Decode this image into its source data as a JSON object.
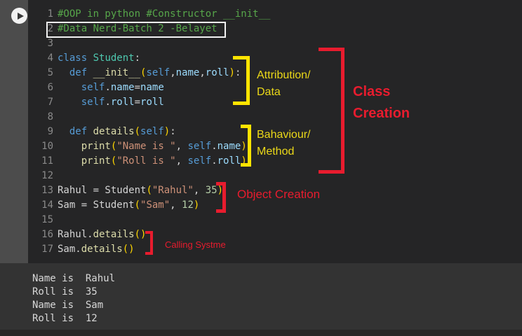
{
  "colors": {
    "editor_bg": "#252526",
    "sidebar_bg": "#4c4c4c",
    "console_bg": "#333333",
    "annotation_yellow": "#ffe400",
    "annotation_red": "#e81c2e",
    "comment_green": "#57a64a",
    "keyword_blue": "#569cd6",
    "function_yellow": "#dcdcaa",
    "string_orange": "#ce9178",
    "number_green": "#b5cea8",
    "param_blue": "#9cdcfe"
  },
  "run_button": {
    "icon": "play-icon"
  },
  "editor": {
    "lines": [
      {
        "num": "1",
        "segments": [
          [
            "com",
            "#OOP in python #Constructor __init__"
          ]
        ]
      },
      {
        "num": "2",
        "segments": [
          [
            "com",
            "#Data Nerd-Batch 2 -Belayet"
          ]
        ]
      },
      {
        "num": "3",
        "segments": []
      },
      {
        "num": "4",
        "segments": [
          [
            "kw",
            "class"
          ],
          [
            "pl",
            " "
          ],
          [
            "cls",
            "Student"
          ],
          [
            "pl",
            ":"
          ]
        ]
      },
      {
        "num": "5",
        "segments": [
          [
            "pl",
            "  "
          ],
          [
            "kw",
            "def"
          ],
          [
            "pl",
            " "
          ],
          [
            "fn",
            "__init__"
          ],
          [
            "gold",
            "("
          ],
          [
            "kw",
            "self"
          ],
          [
            "pl",
            ","
          ],
          [
            "prm",
            "name"
          ],
          [
            "pl",
            ","
          ],
          [
            "prm",
            "roll"
          ],
          [
            "gold",
            ")"
          ],
          [
            "pl",
            ":"
          ]
        ]
      },
      {
        "num": "6",
        "segments": [
          [
            "pl",
            "    "
          ],
          [
            "kw",
            "self"
          ],
          [
            "pl",
            "."
          ],
          [
            "prm",
            "name"
          ],
          [
            "pl",
            "="
          ],
          [
            "prm",
            "name"
          ]
        ]
      },
      {
        "num": "7",
        "segments": [
          [
            "pl",
            "    "
          ],
          [
            "kw",
            "self"
          ],
          [
            "pl",
            "."
          ],
          [
            "prm",
            "roll"
          ],
          [
            "pl",
            "="
          ],
          [
            "prm",
            "roll"
          ]
        ]
      },
      {
        "num": "8",
        "segments": []
      },
      {
        "num": "9",
        "segments": [
          [
            "pl",
            "  "
          ],
          [
            "kw",
            "def"
          ],
          [
            "pl",
            " "
          ],
          [
            "fn",
            "details"
          ],
          [
            "gold",
            "("
          ],
          [
            "kw",
            "self"
          ],
          [
            "gold",
            ")"
          ],
          [
            "pl",
            ":"
          ]
        ]
      },
      {
        "num": "10",
        "segments": [
          [
            "pl",
            "    "
          ],
          [
            "fn",
            "print"
          ],
          [
            "gold",
            "("
          ],
          [
            "str",
            "\"Name is \""
          ],
          [
            "pl",
            ", "
          ],
          [
            "kw",
            "self"
          ],
          [
            "pl",
            "."
          ],
          [
            "prm",
            "name"
          ],
          [
            "gold",
            ")"
          ]
        ]
      },
      {
        "num": "11",
        "segments": [
          [
            "pl",
            "    "
          ],
          [
            "fn",
            "print"
          ],
          [
            "gold",
            "("
          ],
          [
            "str",
            "\"Roll is \""
          ],
          [
            "pl",
            ", "
          ],
          [
            "kw",
            "self"
          ],
          [
            "pl",
            "."
          ],
          [
            "prm",
            "roll"
          ],
          [
            "gold",
            ")"
          ]
        ]
      },
      {
        "num": "12",
        "segments": []
      },
      {
        "num": "13",
        "segments": [
          [
            "pl",
            "Rahul = Student"
          ],
          [
            "gold",
            "("
          ],
          [
            "str",
            "\"Rahul\""
          ],
          [
            "pl",
            ", "
          ],
          [
            "num",
            "35"
          ],
          [
            "gold",
            ")"
          ]
        ]
      },
      {
        "num": "14",
        "segments": [
          [
            "pl",
            "Sam = Student"
          ],
          [
            "gold",
            "("
          ],
          [
            "str",
            "\"Sam\""
          ],
          [
            "pl",
            ", "
          ],
          [
            "num",
            "12"
          ],
          [
            "gold",
            ")"
          ]
        ]
      },
      {
        "num": "15",
        "segments": []
      },
      {
        "num": "16",
        "segments": [
          [
            "pl",
            "Rahul."
          ],
          [
            "fn",
            "details"
          ],
          [
            "gold",
            "()"
          ]
        ]
      },
      {
        "num": "17",
        "segments": [
          [
            "pl",
            "Sam."
          ],
          [
            "fn",
            "details"
          ],
          [
            "gold",
            "()"
          ]
        ]
      }
    ]
  },
  "annotations": {
    "attribution": {
      "line1": "Attribution/",
      "line2": "Data"
    },
    "behaviour": {
      "line1": "Bahaviour/",
      "line2": "Method"
    },
    "class_creation": {
      "line1": "Class",
      "line2": "Creation"
    },
    "object_creation": {
      "text": "Object Creation"
    },
    "calling": {
      "text": "Calling Systme"
    }
  },
  "console": {
    "lines": [
      "Name is  Rahul",
      "Roll is  35",
      "Name is  Sam",
      "Roll is  12"
    ]
  }
}
